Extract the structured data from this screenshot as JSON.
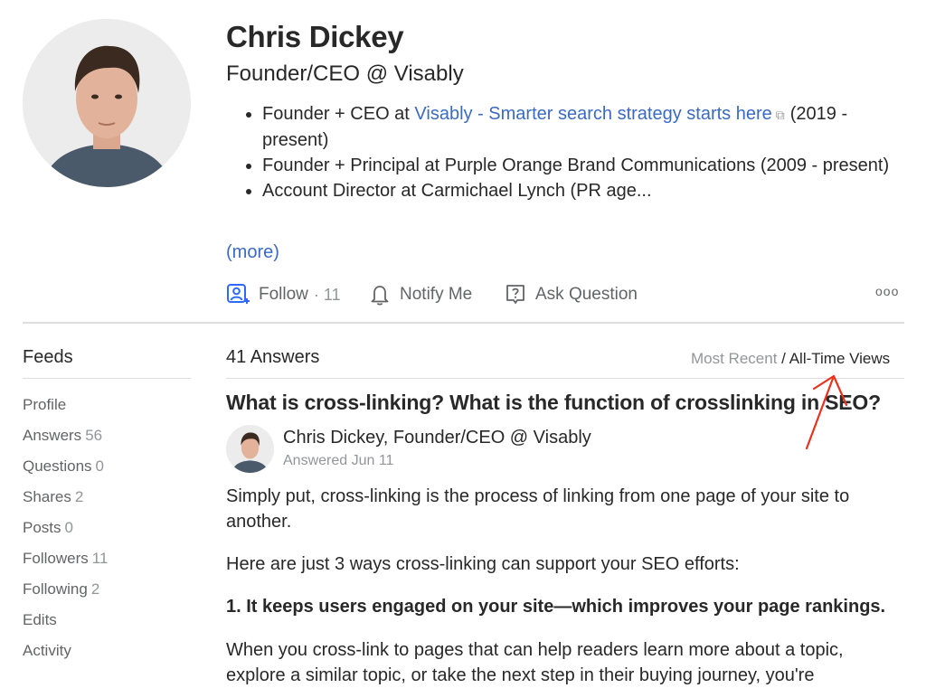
{
  "profile": {
    "name": "Chris Dickey",
    "tagline": "Founder/CEO @ Visably",
    "credentials": {
      "item1_prefix": "Founder + CEO at ",
      "item1_link": "Visably - Smarter search strategy starts here",
      "item1_suffix": "(2019 - present)",
      "item2": "Founder + Principal at Purple Orange Brand Communications (2009 - present)",
      "item3": "Account Director at Carmichael Lynch (PR age..."
    },
    "more_label": "(more)"
  },
  "actions": {
    "follow_label": "Follow",
    "follow_count": "· 11",
    "notify_label": "Notify Me",
    "ask_label": "Ask Question",
    "more_icon": "ooo"
  },
  "sidebar": {
    "title": "Feeds",
    "items": [
      {
        "label": "Profile",
        "count": ""
      },
      {
        "label": "Answers",
        "count": "56"
      },
      {
        "label": "Questions",
        "count": "0"
      },
      {
        "label": "Shares",
        "count": "2"
      },
      {
        "label": "Posts",
        "count": "0"
      },
      {
        "label": "Followers",
        "count": "11"
      },
      {
        "label": "Following",
        "count": "2"
      },
      {
        "label": "Edits",
        "count": ""
      },
      {
        "label": "Activity",
        "count": ""
      }
    ]
  },
  "main": {
    "answers_count": "41 Answers",
    "sort_recent": "Most Recent",
    "sort_separator": "/",
    "sort_views": "All-Time Views",
    "question": "What is cross-linking? What is the function of crosslinking in SEO?",
    "author_line": "Chris Dickey, Founder/CEO @ Visably",
    "answered_date": "Answered Jun 11",
    "paragraph1": "Simply put, cross-linking is the process of linking from one page of your site to another.",
    "paragraph2": "Here are just 3 ways cross-linking can support your SEO efforts:",
    "heading1": "1. It keeps users engaged on your site—which improves your page rankings.",
    "paragraph3": "When you cross-link to pages that can help readers learn more about a topic, explore a similar topic, or take the next step in their buying journey, you're"
  },
  "colors": {
    "link": "#3a6bbf",
    "annotation": "#e8321e"
  }
}
